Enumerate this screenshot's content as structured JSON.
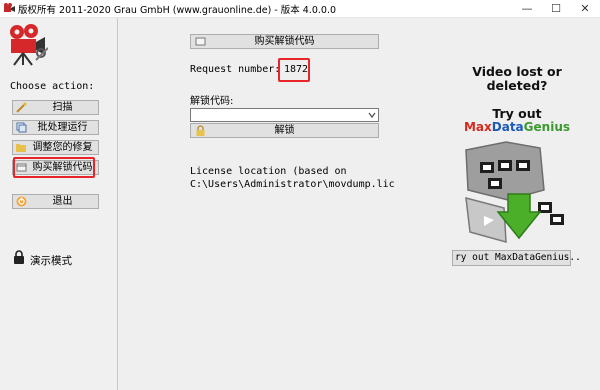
{
  "window": {
    "title": "版权所有 2011-2020 Grau GmbH (www.grauonline.de) - 版本 4.0.0.0",
    "minimize_glyph": "—",
    "maximize_glyph": "☐",
    "close_glyph": "✕"
  },
  "sidebar": {
    "choose_action": "Choose action:",
    "buttons": [
      {
        "label": "扫描",
        "icon": "magic-wand-icon"
      },
      {
        "label": "批处理运行",
        "icon": "batch-icon"
      },
      {
        "label": "调整您的修复",
        "icon": "folder-icon"
      },
      {
        "label": "购买解锁代码",
        "icon": "purchase-icon"
      },
      {
        "label": "退出",
        "icon": "power-icon"
      }
    ],
    "demo_mode": "演示模式"
  },
  "main": {
    "buy_unlock_button": "购买解锁代码",
    "request_number_label": "Request number:",
    "request_number": "1872",
    "unlock_code_label": "解锁代码:",
    "unlock_code_value": "",
    "unlock_button": "解锁",
    "license_location_line1": "License location (based on",
    "license_location_line2": "C:\\Users\\Administrator\\movdump.lic"
  },
  "ad": {
    "headline_line1": "Video lost or",
    "headline_line2": "deleted?",
    "try_out": "Try out",
    "brand_max": "Max",
    "brand_data": "Data",
    "brand_genius": "Genius",
    "button": "ry out MaxDataGenius.."
  },
  "colors": {
    "highlight": "#e8262a",
    "brand_red": "#d42a1e",
    "brand_blue": "#1b59b8",
    "brand_green": "#3a9a2e",
    "button_face": "#e1e1e1"
  }
}
